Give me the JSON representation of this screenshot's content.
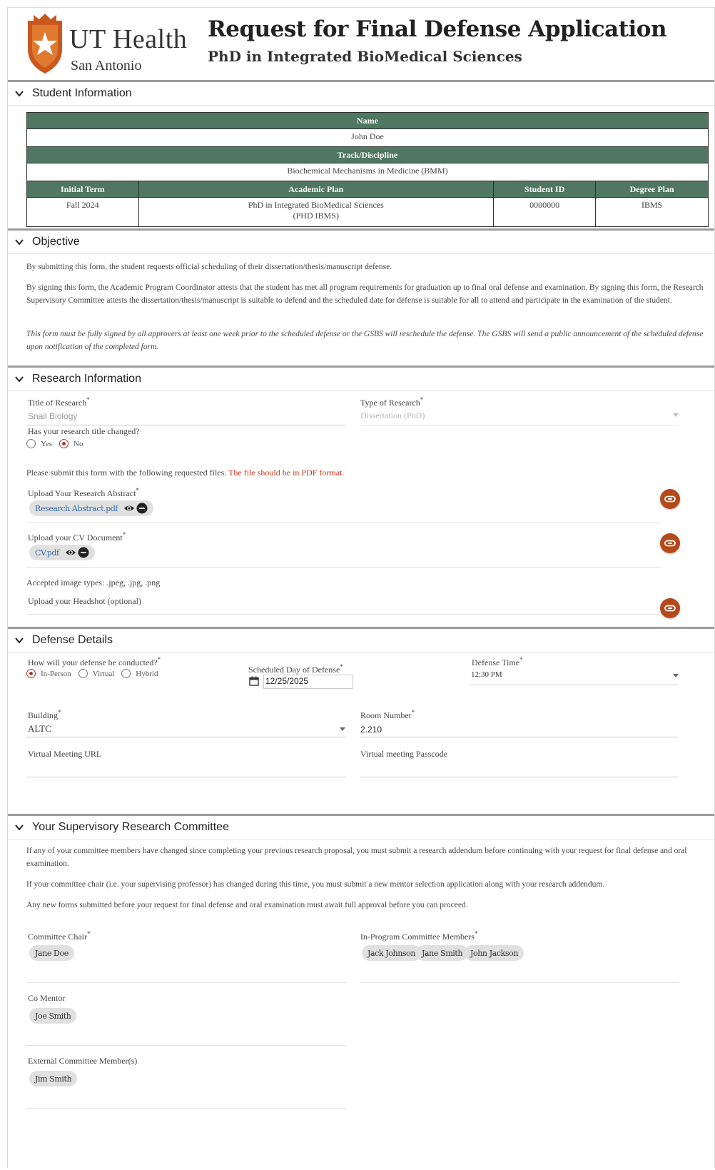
{
  "header": {
    "brand": "UT Health",
    "brand_sub": "San Antonio",
    "title": "Request for Final Defense Application",
    "subtitle": "PhD in Integrated BioMedical Sciences"
  },
  "student": {
    "section_title": "Student Information",
    "name_header": "Name",
    "name": "John Doe",
    "track_header": "Track/Discipline",
    "track": "Biochemical Mechanisms in Medicine (BMM)",
    "col_headers": [
      "Initial Term",
      "Academic Plan",
      "Student ID",
      "Degree Plan"
    ],
    "initial_term": "Fall 2024",
    "academic_plan_1": "PhD in Integrated BioMedical Sciences",
    "academic_plan_2": "(PHD IBMS)",
    "student_id": "0000000",
    "degree_plan": "IBMS"
  },
  "objective": {
    "section_title": "Objective",
    "p1": "By submitting this form, the student requests official scheduling of their dissertation/thesis/manuscript defense.",
    "p2": "By signing this form, the Academic Program Coordinator attests that the student has met all program requirements for graduation up to final oral defense and examination. By signing this form, the Research Supervisory Committee attests the dissertation/thesis/manuscript is suitable to defend and the scheduled date for defense is suitable for all to attend and participate in the examination of the student.",
    "p3": "This form must be fully signed by all approvers at least one week prior to the scheduled defense or the GSBS will reschedule the defense. The GSBS will send a public announcement of the scheduled defense upon notification of the completed form."
  },
  "research": {
    "section_title": "Research Information",
    "title_label": "Title of Research",
    "title_value": "Snail Biology",
    "type_label": "Type of Research",
    "type_value": "Dissertation (PhD)",
    "changed_label": "Has your research title changed?",
    "yes": "Yes",
    "no": "No",
    "submit_note": "Please submit this form with the following requested files.",
    "submit_note_red": "The file should be in PDF format.",
    "abstract_label": "Upload Your Research Abstract",
    "abstract_file": "Research Abstract.pdf",
    "cv_label": "Upload your CV Document",
    "cv_file": "CV.pdf",
    "image_types": "Accepted image types: .jpeg, .jpg, .png",
    "headshot_label": "Upload your Headshot (optional)"
  },
  "defense": {
    "section_title": "Defense Details",
    "how_label": "How will your defense be conducted?",
    "options": [
      "In-Person",
      "Virtual",
      "Hybrid"
    ],
    "day_label": "Scheduled Day of Defense",
    "day_value": "12/25/2025",
    "time_label": "Defense Time",
    "time_value": "12:30 PM",
    "building_label": "Building",
    "building_value": "ALTC",
    "room_label": "Room Number",
    "room_value": "2.210",
    "url_label": "Virtual Meeting URL",
    "pass_label": "Virtual meeting Passcode"
  },
  "committee": {
    "section_title": "Your Supervisory Research Committee",
    "p1": "If any of your committee members have changed since completing your previous research proposal, you must submit a research addendum before continuing with your request for final defense and oral examination.",
    "p2": "If your committee chair (i.e. your supervising professor) has changed during this time, you must submit a new mentor selection application along with your research addendum.",
    "p3": "Any new forms submitted before your request for final defense and oral examination must await full approval before you can proceed.",
    "chair_label": "Committee Chair",
    "chair": "Jane Doe",
    "members_label": "In-Program Committee Members",
    "members": [
      "Jack Johnson",
      "Jane Smith",
      "John Jackson"
    ],
    "comentor_label": "Co Mentor",
    "comentor": "Joe Smith",
    "external_label": "External Committee Member(s)",
    "external": "Jim Smith"
  },
  "colors": {
    "table_header": "#4f7762",
    "accent": "#b4491a",
    "alert": "#c8361f"
  }
}
